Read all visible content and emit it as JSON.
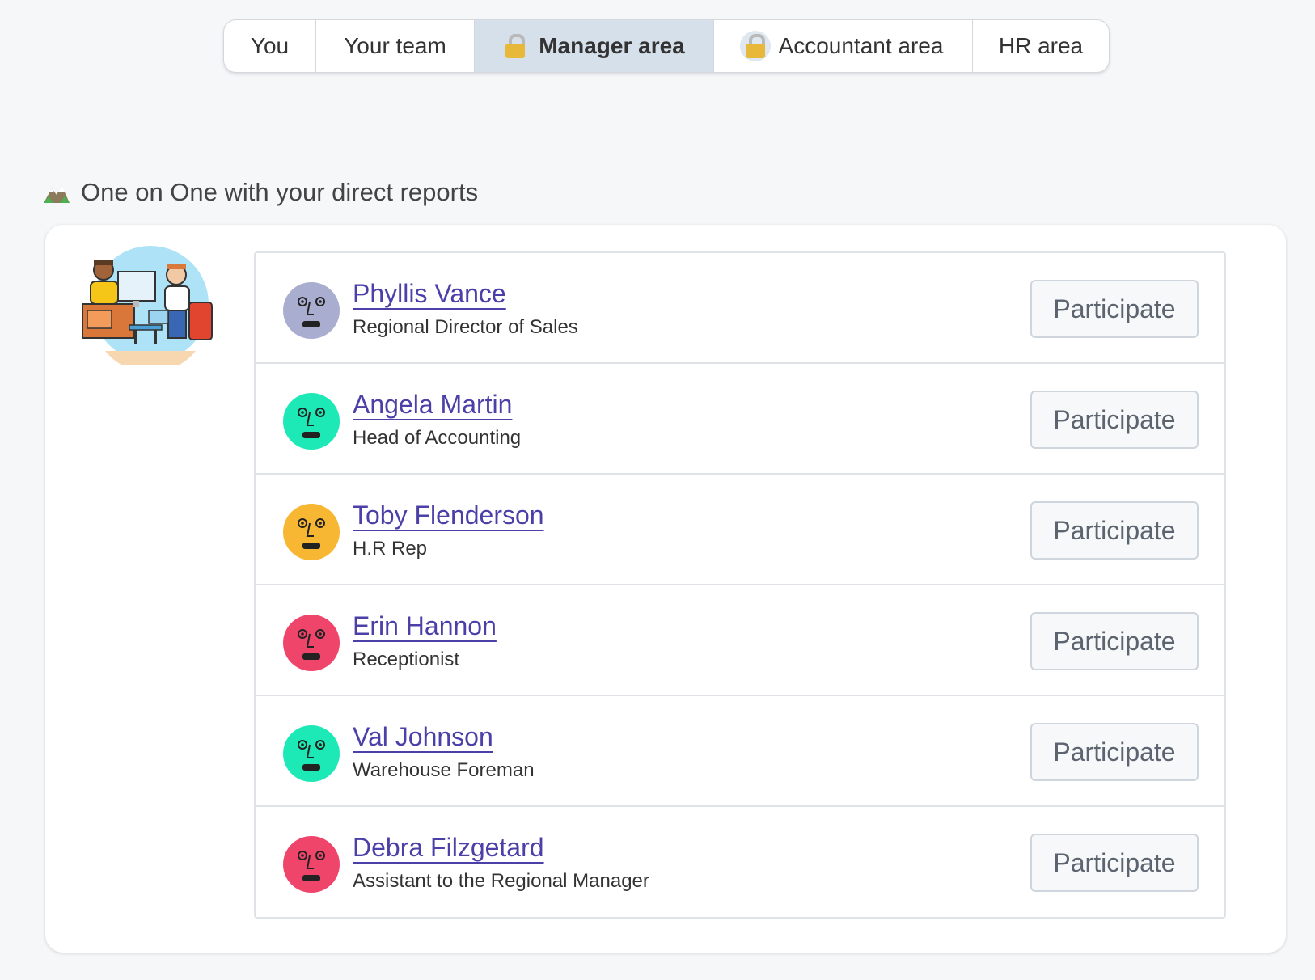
{
  "tabs": [
    {
      "label": "You",
      "locked": false,
      "active": false
    },
    {
      "label": "Your team",
      "locked": false,
      "active": false
    },
    {
      "label": "Manager area",
      "locked": true,
      "active": true
    },
    {
      "label": "Accountant area",
      "locked": true,
      "active": false
    },
    {
      "label": "HR area",
      "locked": false,
      "active": false
    }
  ],
  "section": {
    "title": "One on One with your direct reports",
    "icon": "mountain-icon"
  },
  "reports": [
    {
      "name": "Phyllis Vance",
      "role": "Regional Director of Sales",
      "avatar_color": "#a9adcf",
      "action": "Participate"
    },
    {
      "name": "Angela Martin",
      "role": "Head of Accounting",
      "avatar_color": "#1de9b6",
      "action": "Participate"
    },
    {
      "name": "Toby Flenderson",
      "role": "H.R Rep",
      "avatar_color": "#f7b733",
      "action": "Participate"
    },
    {
      "name": "Erin Hannon",
      "role": "Receptionist",
      "avatar_color": "#f0456b",
      "action": "Participate"
    },
    {
      "name": "Val Johnson",
      "role": "Warehouse Foreman",
      "avatar_color": "#1de9b6",
      "action": "Participate"
    },
    {
      "name": "Debra Filzgetard",
      "role": "Assistant to the Regional Manager",
      "avatar_color": "#f0456b",
      "action": "Participate"
    }
  ],
  "colors": {
    "link": "#4b3fa8",
    "active_tab_bg": "#d6e0ea",
    "page_bg": "#f6f7f9"
  }
}
